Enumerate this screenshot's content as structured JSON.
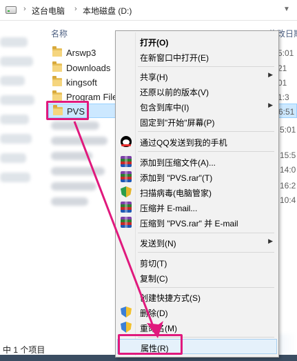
{
  "address": {
    "crumbs": [
      "这台电脑",
      "本地磁盘 (D:)"
    ],
    "drive_icon": "drive-icon",
    "dropdown_icon": "chevron-down-icon"
  },
  "filelist": {
    "col_name": "名称",
    "col_date": "修改日期",
    "rows": [
      {
        "name": "Arswp3",
        "date": "5:01",
        "selected": false
      },
      {
        "name": "Downloads",
        "date": "21",
        "selected": false
      },
      {
        "name": "kingsoft",
        "date": "01",
        "selected": false
      },
      {
        "name": "Program Files",
        "date": "1:3",
        "selected": false
      },
      {
        "name": "PVS",
        "date": "6:51",
        "selected": true
      }
    ],
    "blurred_dates": [
      "5:01",
      "15:5",
      "14:0",
      "16:2",
      "10:4"
    ]
  },
  "status": {
    "text": "中 1 个项目"
  },
  "context_menu": {
    "items": [
      {
        "label": "打开(O)",
        "bold": true
      },
      {
        "label": "在新窗口中打开(E)"
      },
      {
        "separator": true
      },
      {
        "label": "共享(H)",
        "submenu": true
      },
      {
        "label": "还原以前的版本(V)"
      },
      {
        "label": "包含到库中(I)",
        "submenu": true
      },
      {
        "label": "固定到\"开始\"屏幕(P)"
      },
      {
        "separator": true
      },
      {
        "label": "通过QQ发送到我的手机",
        "icon": "qq-icon"
      },
      {
        "separator": true
      },
      {
        "label": "添加到压缩文件(A)...",
        "icon": "winrar-icon"
      },
      {
        "label": "添加到 \"PVS.rar\"(T)",
        "icon": "winrar-icon"
      },
      {
        "label": "扫描病毒(电脑管家)",
        "icon": "tencent-shield-icon"
      },
      {
        "label": "压缩并 E-mail...",
        "icon": "winrar-icon"
      },
      {
        "label": "压缩到 \"PVS.rar\" 并 E-mail",
        "icon": "winrar-icon"
      },
      {
        "separator": true
      },
      {
        "label": "发送到(N)",
        "submenu": true
      },
      {
        "separator": true
      },
      {
        "label": "剪切(T)"
      },
      {
        "label": "复制(C)"
      },
      {
        "separator": true
      },
      {
        "label": "创建快捷方式(S)"
      },
      {
        "label": "删除(D)",
        "icon": "uac-shield-icon"
      },
      {
        "label": "重命名(M)",
        "icon": "uac-shield-icon"
      },
      {
        "separator": true
      },
      {
        "label": "属性(R)",
        "highlighted": true
      }
    ]
  },
  "annotation": {
    "color": "#e0197d"
  }
}
